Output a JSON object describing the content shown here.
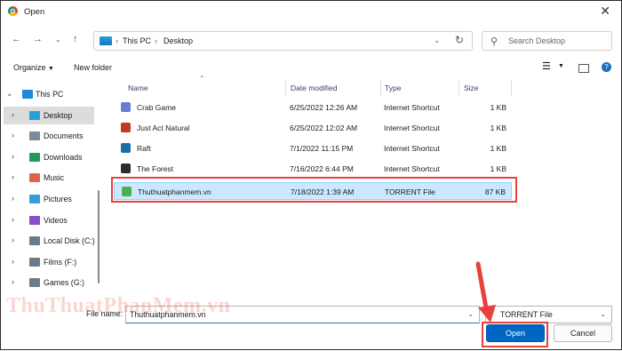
{
  "window": {
    "title": "Open"
  },
  "nav": {
    "breadcrumb": [
      "This PC",
      "Desktop"
    ],
    "search_placeholder": "Search Desktop"
  },
  "commands": {
    "organize": "Organize",
    "new_folder": "New folder"
  },
  "sidebar": {
    "items": [
      {
        "label": "This PC",
        "icon": "pc-icon",
        "color": "#1c8ad8",
        "expanded": true
      },
      {
        "label": "Desktop",
        "icon": "desktop-icon",
        "color": "#2a9fd6",
        "selected": true
      },
      {
        "label": "Documents",
        "icon": "documents-icon",
        "color": "#7a8a9a"
      },
      {
        "label": "Downloads",
        "icon": "downloads-icon",
        "color": "#1f9d55"
      },
      {
        "label": "Music",
        "icon": "music-icon",
        "color": "#e0634a"
      },
      {
        "label": "Pictures",
        "icon": "pictures-icon",
        "color": "#3b9ad9"
      },
      {
        "label": "Videos",
        "icon": "videos-icon",
        "color": "#8a4fc7"
      },
      {
        "label": "Local Disk (C:)",
        "icon": "drive-icon",
        "color": "#6b7b8b"
      },
      {
        "label": "Films (F:)",
        "icon": "drive-icon",
        "color": "#6b7b8b"
      },
      {
        "label": "Games (G:)",
        "icon": "drive-icon",
        "color": "#6b7b8b"
      }
    ]
  },
  "columns": {
    "name": "Name",
    "date": "Date modified",
    "type": "Type",
    "size": "Size"
  },
  "files": [
    {
      "name": "Crab Game",
      "date": "6/25/2022 12:26 AM",
      "type": "Internet Shortcut",
      "size": "1 KB",
      "icon": "crab-game-icon",
      "color": "#6a7bd0"
    },
    {
      "name": "Just Act Natural",
      "date": "6/25/2022 12:02 AM",
      "type": "Internet Shortcut",
      "size": "1 KB",
      "icon": "just-act-natural-icon",
      "color": "#c0392b"
    },
    {
      "name": "Raft",
      "date": "7/1/2022 11:15 PM",
      "type": "Internet Shortcut",
      "size": "1 KB",
      "icon": "raft-icon",
      "color": "#1d6fa5"
    },
    {
      "name": "The Forest",
      "date": "7/16/2022 6:44 PM",
      "type": "Internet Shortcut",
      "size": "1 KB",
      "icon": "the-forest-icon",
      "color": "#2c2c2c"
    },
    {
      "name": "Thuthuatphanmem.vn",
      "date": "7/18/2022 1:39 AM",
      "type": "TORRENT File",
      "size": "87 KB",
      "icon": "torrent-icon",
      "color": "#4caf50",
      "selected": true
    }
  ],
  "footer": {
    "file_name_label": "File name:",
    "file_name_value": "Thuthuatphanmem.vn",
    "file_type_value": "TORRENT File",
    "open_label": "Open",
    "cancel_label": "Cancel"
  },
  "watermark": {
    "part1": "ThuThuat",
    "part2": "PhanMem",
    "part3": ".vn"
  },
  "colors": {
    "accent": "#0066c3",
    "highlight": "#e8403b",
    "selection": "#cce8ff"
  }
}
